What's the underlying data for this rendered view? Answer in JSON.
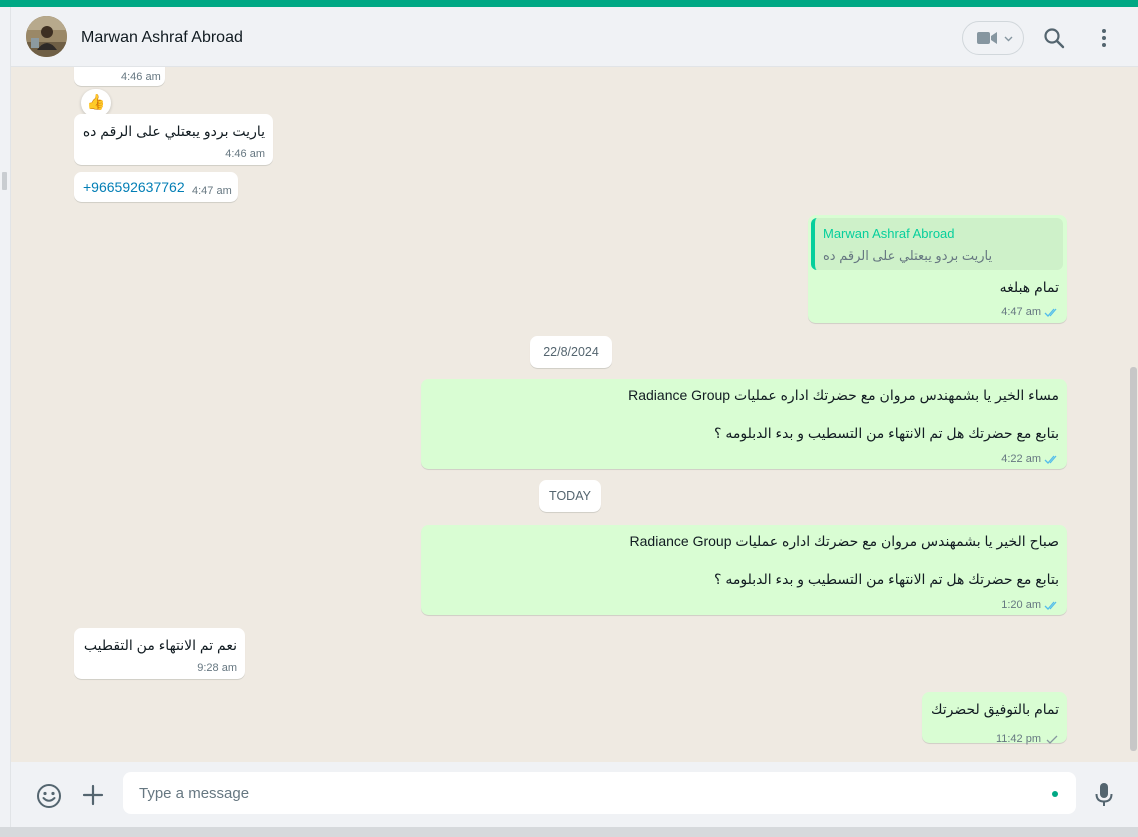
{
  "header": {
    "contact_name": "Marwan Ashraf Abroad",
    "icons": [
      "avatar",
      "video-call-icon",
      "chevron-down-icon",
      "search-icon",
      "kebab-menu-icon"
    ]
  },
  "messages": [
    {
      "id": "m1",
      "direction": "in",
      "time": "4:46 am",
      "reaction": "👍"
    },
    {
      "id": "m2",
      "direction": "in",
      "text": "ياريت بردو يبعتلي على الرقم ده",
      "time": "4:46 am"
    },
    {
      "id": "m3",
      "direction": "in",
      "text": "+966592637762",
      "time": "4:47 am"
    },
    {
      "id": "m4",
      "direction": "out",
      "quote_name": "Marwan Ashraf Abroad",
      "quote_text": "ياريت بردو يبعتلي على الرقم ده",
      "text": "تمام هبلغه",
      "time": "4:47 am",
      "status": "read"
    },
    {
      "id": "m5",
      "direction": "out",
      "line1": "مساء الخير يا بشمهندس مروان مع  حضرتك اداره عمليات Radiance Group",
      "line2": "بتابع مع حضرتك هل تم الانتهاء من التسطيب و بدء الدبلومه ؟",
      "time": "4:22 am",
      "status": "read"
    },
    {
      "id": "m6",
      "direction": "out",
      "line1": "صباح الخير يا بشمهندس مروان مع  حضرتك اداره عمليات Radiance Group",
      "line2": "بتابع مع حضرتك هل تم الانتهاء من التسطيب و بدء الدبلومه ؟",
      "time": "1:20 am",
      "status": "read"
    },
    {
      "id": "m7",
      "direction": "in",
      "text": "نعم تم الانتهاء من التقطيب",
      "time": "9:28 am"
    },
    {
      "id": "m8",
      "direction": "out",
      "text": "تمام بالتوفيق لحضرتك",
      "time": "11:42 pm",
      "status": "sent"
    }
  ],
  "date_chips": {
    "d1": "22/8/2024",
    "d2": "TODAY"
  },
  "footer": {
    "placeholder": "Type a message",
    "icons": [
      "emoji-icon",
      "plus-icon",
      "microphone-icon"
    ]
  },
  "colors": {
    "accent": "#00a884",
    "outgoing_bubble": "#d9fdd3",
    "incoming_bubble": "#ffffff",
    "chat_bg": "#efeae2",
    "read_ticks": "#53bdeb"
  }
}
